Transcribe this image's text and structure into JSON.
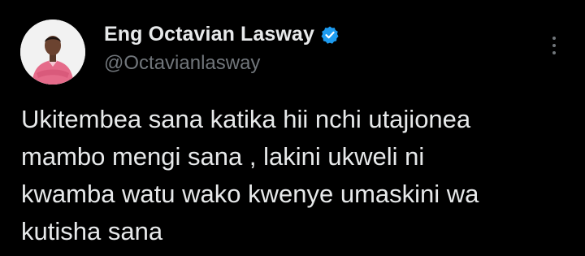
{
  "author": {
    "display_name": "Eng Octavian Lasway",
    "handle": "@Octavianlasway",
    "verified": true,
    "avatar_icon": "profile-photo-icon",
    "badge_icon": "verified-badge-icon"
  },
  "tweet": {
    "lines": [
      "Ukitembea sana katika hii nchi utajionea",
      "mambo mengi sana , lakini ukweli ni",
      "kwamba watu wako kwenye umaskini wa",
      "kutisha sana"
    ]
  },
  "actions": {
    "more_icon": "more-options-icon"
  },
  "colors": {
    "background": "#000000",
    "text": "#e7e9ea",
    "secondary_text": "#71767b",
    "verified_blue": "#1d9bf0"
  }
}
